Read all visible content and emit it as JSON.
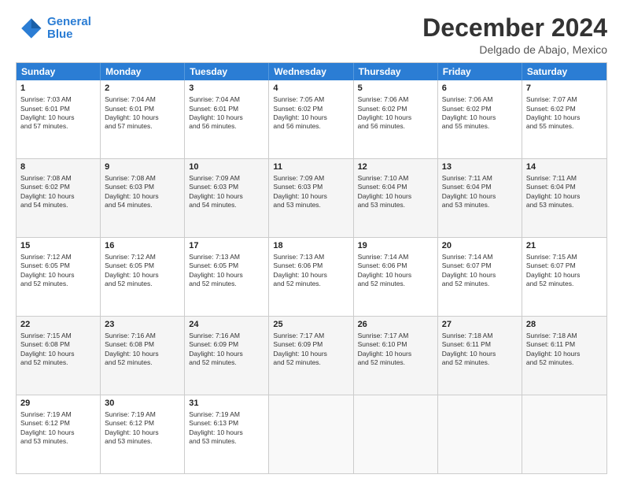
{
  "logo": {
    "line1": "General",
    "line2": "Blue"
  },
  "title": "December 2024",
  "subtitle": "Delgado de Abajo, Mexico",
  "header": {
    "days": [
      "Sunday",
      "Monday",
      "Tuesday",
      "Wednesday",
      "Thursday",
      "Friday",
      "Saturday"
    ]
  },
  "weeks": [
    [
      {
        "day": "1",
        "lines": [
          "Sunrise: 7:03 AM",
          "Sunset: 6:01 PM",
          "Daylight: 10 hours",
          "and 57 minutes."
        ]
      },
      {
        "day": "2",
        "lines": [
          "Sunrise: 7:04 AM",
          "Sunset: 6:01 PM",
          "Daylight: 10 hours",
          "and 57 minutes."
        ]
      },
      {
        "day": "3",
        "lines": [
          "Sunrise: 7:04 AM",
          "Sunset: 6:01 PM",
          "Daylight: 10 hours",
          "and 56 minutes."
        ]
      },
      {
        "day": "4",
        "lines": [
          "Sunrise: 7:05 AM",
          "Sunset: 6:02 PM",
          "Daylight: 10 hours",
          "and 56 minutes."
        ]
      },
      {
        "day": "5",
        "lines": [
          "Sunrise: 7:06 AM",
          "Sunset: 6:02 PM",
          "Daylight: 10 hours",
          "and 56 minutes."
        ]
      },
      {
        "day": "6",
        "lines": [
          "Sunrise: 7:06 AM",
          "Sunset: 6:02 PM",
          "Daylight: 10 hours",
          "and 55 minutes."
        ]
      },
      {
        "day": "7",
        "lines": [
          "Sunrise: 7:07 AM",
          "Sunset: 6:02 PM",
          "Daylight: 10 hours",
          "and 55 minutes."
        ]
      }
    ],
    [
      {
        "day": "8",
        "lines": [
          "Sunrise: 7:08 AM",
          "Sunset: 6:02 PM",
          "Daylight: 10 hours",
          "and 54 minutes."
        ]
      },
      {
        "day": "9",
        "lines": [
          "Sunrise: 7:08 AM",
          "Sunset: 6:03 PM",
          "Daylight: 10 hours",
          "and 54 minutes."
        ]
      },
      {
        "day": "10",
        "lines": [
          "Sunrise: 7:09 AM",
          "Sunset: 6:03 PM",
          "Daylight: 10 hours",
          "and 54 minutes."
        ]
      },
      {
        "day": "11",
        "lines": [
          "Sunrise: 7:09 AM",
          "Sunset: 6:03 PM",
          "Daylight: 10 hours",
          "and 53 minutes."
        ]
      },
      {
        "day": "12",
        "lines": [
          "Sunrise: 7:10 AM",
          "Sunset: 6:04 PM",
          "Daylight: 10 hours",
          "and 53 minutes."
        ]
      },
      {
        "day": "13",
        "lines": [
          "Sunrise: 7:11 AM",
          "Sunset: 6:04 PM",
          "Daylight: 10 hours",
          "and 53 minutes."
        ]
      },
      {
        "day": "14",
        "lines": [
          "Sunrise: 7:11 AM",
          "Sunset: 6:04 PM",
          "Daylight: 10 hours",
          "and 53 minutes."
        ]
      }
    ],
    [
      {
        "day": "15",
        "lines": [
          "Sunrise: 7:12 AM",
          "Sunset: 6:05 PM",
          "Daylight: 10 hours",
          "and 52 minutes."
        ]
      },
      {
        "day": "16",
        "lines": [
          "Sunrise: 7:12 AM",
          "Sunset: 6:05 PM",
          "Daylight: 10 hours",
          "and 52 minutes."
        ]
      },
      {
        "day": "17",
        "lines": [
          "Sunrise: 7:13 AM",
          "Sunset: 6:05 PM",
          "Daylight: 10 hours",
          "and 52 minutes."
        ]
      },
      {
        "day": "18",
        "lines": [
          "Sunrise: 7:13 AM",
          "Sunset: 6:06 PM",
          "Daylight: 10 hours",
          "and 52 minutes."
        ]
      },
      {
        "day": "19",
        "lines": [
          "Sunrise: 7:14 AM",
          "Sunset: 6:06 PM",
          "Daylight: 10 hours",
          "and 52 minutes."
        ]
      },
      {
        "day": "20",
        "lines": [
          "Sunrise: 7:14 AM",
          "Sunset: 6:07 PM",
          "Daylight: 10 hours",
          "and 52 minutes."
        ]
      },
      {
        "day": "21",
        "lines": [
          "Sunrise: 7:15 AM",
          "Sunset: 6:07 PM",
          "Daylight: 10 hours",
          "and 52 minutes."
        ]
      }
    ],
    [
      {
        "day": "22",
        "lines": [
          "Sunrise: 7:15 AM",
          "Sunset: 6:08 PM",
          "Daylight: 10 hours",
          "and 52 minutes."
        ]
      },
      {
        "day": "23",
        "lines": [
          "Sunrise: 7:16 AM",
          "Sunset: 6:08 PM",
          "Daylight: 10 hours",
          "and 52 minutes."
        ]
      },
      {
        "day": "24",
        "lines": [
          "Sunrise: 7:16 AM",
          "Sunset: 6:09 PM",
          "Daylight: 10 hours",
          "and 52 minutes."
        ]
      },
      {
        "day": "25",
        "lines": [
          "Sunrise: 7:17 AM",
          "Sunset: 6:09 PM",
          "Daylight: 10 hours",
          "and 52 minutes."
        ]
      },
      {
        "day": "26",
        "lines": [
          "Sunrise: 7:17 AM",
          "Sunset: 6:10 PM",
          "Daylight: 10 hours",
          "and 52 minutes."
        ]
      },
      {
        "day": "27",
        "lines": [
          "Sunrise: 7:18 AM",
          "Sunset: 6:11 PM",
          "Daylight: 10 hours",
          "and 52 minutes."
        ]
      },
      {
        "day": "28",
        "lines": [
          "Sunrise: 7:18 AM",
          "Sunset: 6:11 PM",
          "Daylight: 10 hours",
          "and 52 minutes."
        ]
      }
    ],
    [
      {
        "day": "29",
        "lines": [
          "Sunrise: 7:19 AM",
          "Sunset: 6:12 PM",
          "Daylight: 10 hours",
          "and 53 minutes."
        ]
      },
      {
        "day": "30",
        "lines": [
          "Sunrise: 7:19 AM",
          "Sunset: 6:12 PM",
          "Daylight: 10 hours",
          "and 53 minutes."
        ]
      },
      {
        "day": "31",
        "lines": [
          "Sunrise: 7:19 AM",
          "Sunset: 6:13 PM",
          "Daylight: 10 hours",
          "and 53 minutes."
        ]
      },
      {
        "day": "",
        "lines": []
      },
      {
        "day": "",
        "lines": []
      },
      {
        "day": "",
        "lines": []
      },
      {
        "day": "",
        "lines": []
      }
    ]
  ]
}
